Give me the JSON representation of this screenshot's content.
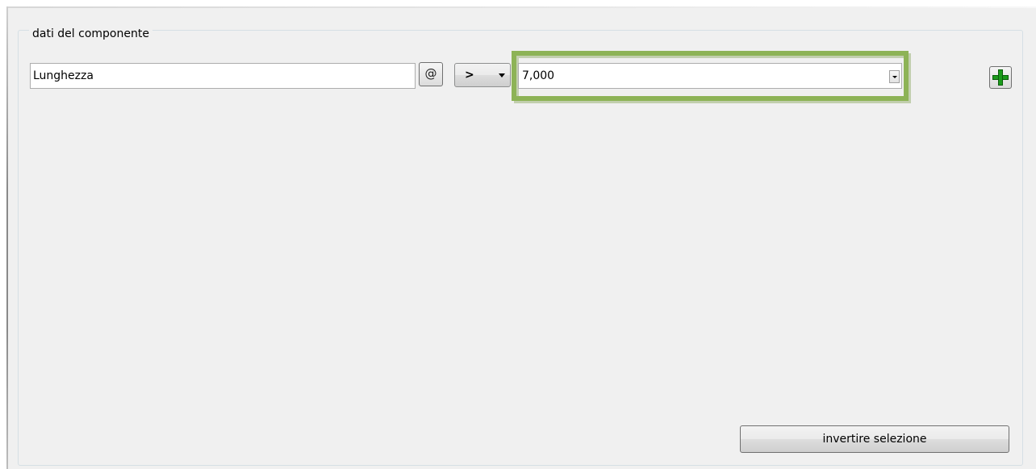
{
  "group": {
    "title": "dati del componente"
  },
  "filter": {
    "field_value": "Lunghezza",
    "at_label": "@",
    "operator_value": ">",
    "value_input": "7,000"
  },
  "colors": {
    "highlight": "#8db356",
    "add_icon": "#1c9b1c",
    "panel_bg": "#f0f0f0"
  },
  "icons": {
    "add": "plus-icon",
    "combo": "chevron-down-icon"
  },
  "actions": {
    "invert_label": "invertire selezione"
  }
}
